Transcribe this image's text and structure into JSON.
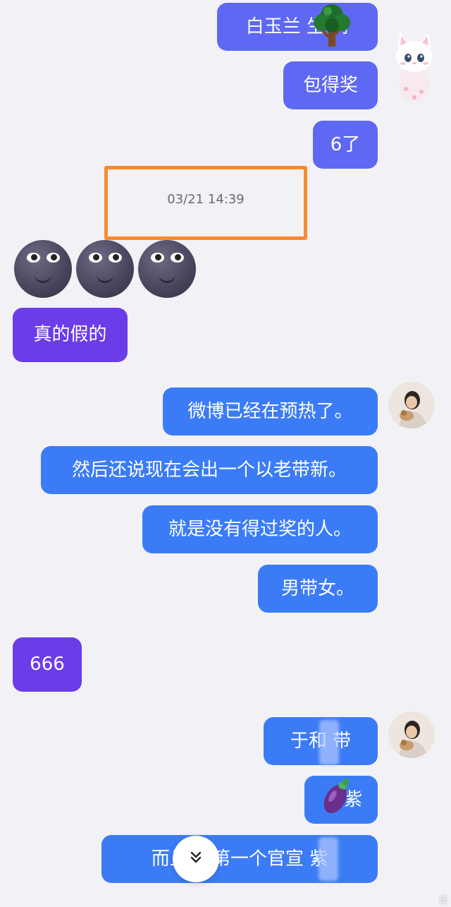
{
  "timestamp": "03/21 14:39",
  "messages": {
    "m1": "白玉兰 生  树",
    "m2": "包得奖",
    "m3": "6了",
    "m5": "真的假的",
    "m6": "微博已经在预热了。",
    "m7": "然后还说现在会出一个以老带新。",
    "m8": "就是没有得过奖的人。",
    "m9": "男带女。",
    "m10": "666",
    "m11": "于和  带",
    "m12": "紫",
    "m13": "而且白     第一个官宣  紫"
  },
  "watermark": "皮",
  "colors": {
    "bubble_indigo": "#5e68f2",
    "bubble_blue": "#3b7cf6",
    "bubble_purple": "#6b3ce8",
    "timestamp_highlight": "#fb8a2b"
  },
  "icons": {
    "tree": "tree-icon",
    "moon": "new-moon-face-emoji",
    "eggplant": "eggplant-icon",
    "scroll": "double-chevron-down-icon"
  }
}
